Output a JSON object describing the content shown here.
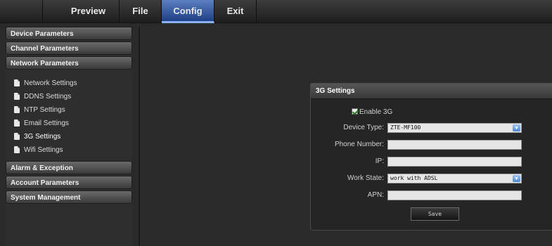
{
  "menu": {
    "tabs": [
      {
        "label": "Preview"
      },
      {
        "label": "File"
      },
      {
        "label": "Config"
      },
      {
        "label": "Exit"
      }
    ],
    "active_tab": "Config"
  },
  "sidebar": {
    "categories": [
      {
        "label": "Device Parameters"
      },
      {
        "label": "Channel Parameters"
      },
      {
        "label": "Network Parameters"
      },
      {
        "label": "Alarm & Exception"
      },
      {
        "label": "Account Parameters"
      },
      {
        "label": "System Management"
      }
    ],
    "network_items": [
      {
        "label": "Network Settings"
      },
      {
        "label": "DDNS Settings"
      },
      {
        "label": "NTP Settings"
      },
      {
        "label": "Email Settings"
      },
      {
        "label": "3G Settings"
      },
      {
        "label": "Wifi Settings"
      }
    ]
  },
  "panel": {
    "title": "3G Settings",
    "enable_label": "Enable 3G",
    "enabled": true,
    "device_type_label": "Device Type:",
    "device_type_value": "ZTE-MF100",
    "phone_number_label": "Phone Number:",
    "phone_number_value": "",
    "ip_label": "IP:",
    "ip_value": "",
    "work_state_label": "Work State:",
    "work_state_value": "work with ADSL",
    "apn_label": "APN:",
    "apn_value": "",
    "save_label": "Save"
  },
  "colors": {
    "active_tab": "#2f55a0",
    "checkbox_check": "#1f7a1f",
    "dropdown_button": "#4a86d0"
  },
  "icons": {
    "dropdown": "chevron-down-icon",
    "sub_item": "document-icon"
  }
}
